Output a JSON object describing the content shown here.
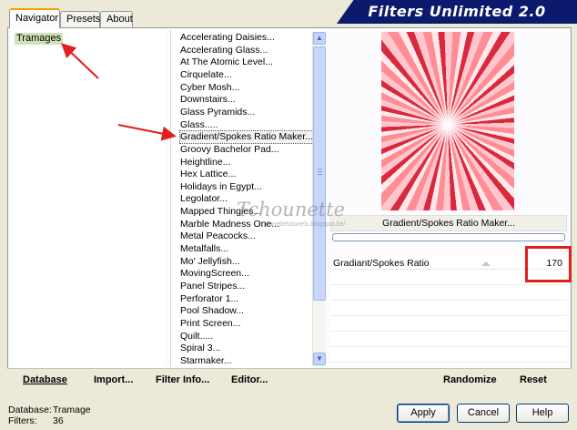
{
  "tabs": [
    {
      "label": "Navigator",
      "active": true
    },
    {
      "label": "Presets",
      "active": false
    },
    {
      "label": "About",
      "active": false
    }
  ],
  "banner": {
    "title": "Filters Unlimited 2.0"
  },
  "categories": [
    {
      "label": "Tramages",
      "selected": true
    }
  ],
  "filters": [
    "Accelerating Daisies...",
    "Accelerating Glass...",
    "At The Atomic Level...",
    "Cirquelate...",
    "Cyber Mosh...",
    "Downstairs...",
    "Glass Pyramids...",
    "Glass.....",
    "Gradient/Spokes Ratio Maker...",
    "Groovy Bachelor Pad...",
    "Heightline...",
    "Hex Lattice...",
    "Holidays in Egypt...",
    "Legolator...",
    "Mapped Thingies...",
    "Marble Madness One...",
    "Metal Peacocks...",
    "Metalfalls...",
    "Mo' Jellyfish...",
    "MovingScreen...",
    "Panel Stripes...",
    "Perforator 1...",
    "Pool Shadow...",
    "Print Screen...",
    "Quilt.....",
    "Spiral 3...",
    "Starmaker..."
  ],
  "selected_filter": "Gradient/Spokes Ratio Maker...",
  "preview": {
    "filter_title": "Gradient/Spokes Ratio Maker..."
  },
  "params": [
    {
      "label": "Gradiant/Spokes Ratio",
      "value": "170"
    }
  ],
  "bottom_toolbar": {
    "database": "Database",
    "import": "Import...",
    "filter_info": "Filter Info...",
    "editor": "Editor...",
    "randomize": "Randomize",
    "reset": "Reset"
  },
  "status": {
    "database_label": "Database:",
    "database_value": "Tramage",
    "filters_label": "Filters:",
    "filters_value": "36"
  },
  "buttons": {
    "apply": "Apply",
    "cancel": "Cancel",
    "help": "Help"
  },
  "watermark": {
    "text": "Tchounette",
    "sub": "chounettetutoriels.blogspot.be/"
  },
  "icons": {
    "scroll_up": "scroll-up-icon",
    "scroll_down": "scroll-down-icon"
  },
  "colors": {
    "banner_bg": "#0c1a6e",
    "annotation_red": "#e21e1e",
    "category_highlight": "#cde3b7"
  }
}
